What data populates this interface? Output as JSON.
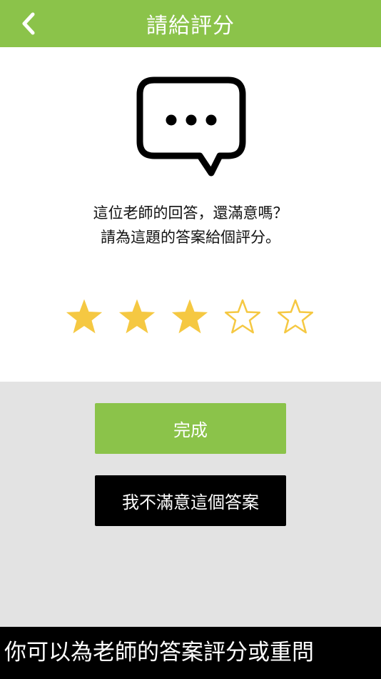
{
  "header": {
    "title": "請給評分",
    "back_icon": "chevron-left-icon"
  },
  "prompt": {
    "icon": "chat-bubble-ellipsis-icon",
    "line1": "這位老師的回答，還滿意嗎？",
    "line2": "請為這題的答案給個評分。"
  },
  "rating": {
    "value": 3,
    "max": 5,
    "filled_color": "#f5c842",
    "empty_color": "#f5c842"
  },
  "actions": {
    "done_label": "完成",
    "unsatisfied_label": "我不滿意這個答案"
  },
  "caption": {
    "text": "你可以為老師的答案評分或重問"
  },
  "colors": {
    "accent": "#8bc34a",
    "dark_button": "#000000",
    "background": "#e3e3e3"
  }
}
